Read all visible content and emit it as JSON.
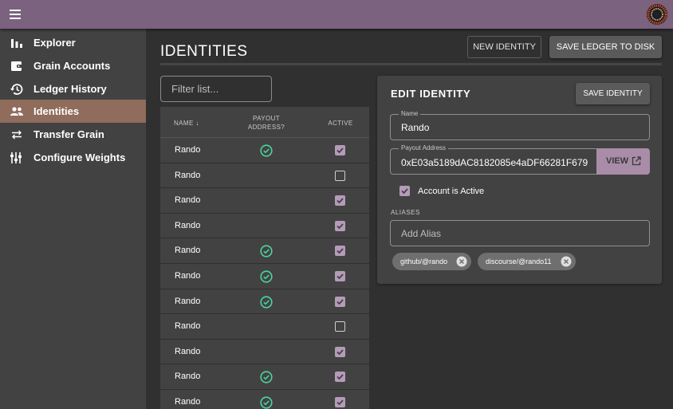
{
  "sidebar": {
    "items": [
      {
        "label": "Explorer",
        "icon": "bar-chart-icon"
      },
      {
        "label": "Grain Accounts",
        "icon": "wallet-icon"
      },
      {
        "label": "Ledger History",
        "icon": "history-icon"
      },
      {
        "label": "Identities",
        "icon": "people-icon",
        "active": true
      },
      {
        "label": "Transfer Grain",
        "icon": "swap-arrows-icon"
      },
      {
        "label": "Configure Weights",
        "icon": "tune-sliders-icon"
      }
    ]
  },
  "header": {
    "title": "IDENTITIES",
    "new_identity_label": "NEW IDENTITY",
    "save_ledger_label": "SAVE LEDGER TO DISK"
  },
  "filter": {
    "placeholder": "Filter list..."
  },
  "table": {
    "columns": {
      "name": "NAME ↓",
      "payout_1": "PAYOUT",
      "payout_2": "ADDRESS?",
      "active": "ACTIVE"
    },
    "rows": [
      {
        "name": "Rando",
        "payout": true,
        "active": true
      },
      {
        "name": "Rando",
        "payout": false,
        "active": false
      },
      {
        "name": "Rando",
        "payout": false,
        "active": true
      },
      {
        "name": "Rando",
        "payout": false,
        "active": true
      },
      {
        "name": "Rando",
        "payout": true,
        "active": true
      },
      {
        "name": "Rando",
        "payout": true,
        "active": true
      },
      {
        "name": "Rando",
        "payout": true,
        "active": true
      },
      {
        "name": "Rando",
        "payout": false,
        "active": false
      },
      {
        "name": "Rando",
        "payout": false,
        "active": true
      },
      {
        "name": "Rando",
        "payout": true,
        "active": true
      },
      {
        "name": "Rando",
        "payout": true,
        "active": true
      }
    ]
  },
  "edit": {
    "title": "EDIT IDENTITY",
    "save_label": "SAVE IDENTITY",
    "name_label": "Name",
    "name_value": "Rando",
    "payout_label": "Payout Address",
    "payout_value": "0xE03a5189dAC8182085e4aDF66281F679",
    "view_label": "VIEW",
    "active_label": "Account is Active",
    "aliases_label": "ALIASES",
    "alias_placeholder": "Add Alias",
    "aliases": [
      "github/@rando",
      "discourse/@rando11"
    ]
  },
  "colors": {
    "appbar": "#7b627f",
    "sidebar_active": "#8f6c5c",
    "checkbox": "#b59ab9",
    "check_green": "#4ad4a0",
    "view_button": "#a98ca8"
  }
}
